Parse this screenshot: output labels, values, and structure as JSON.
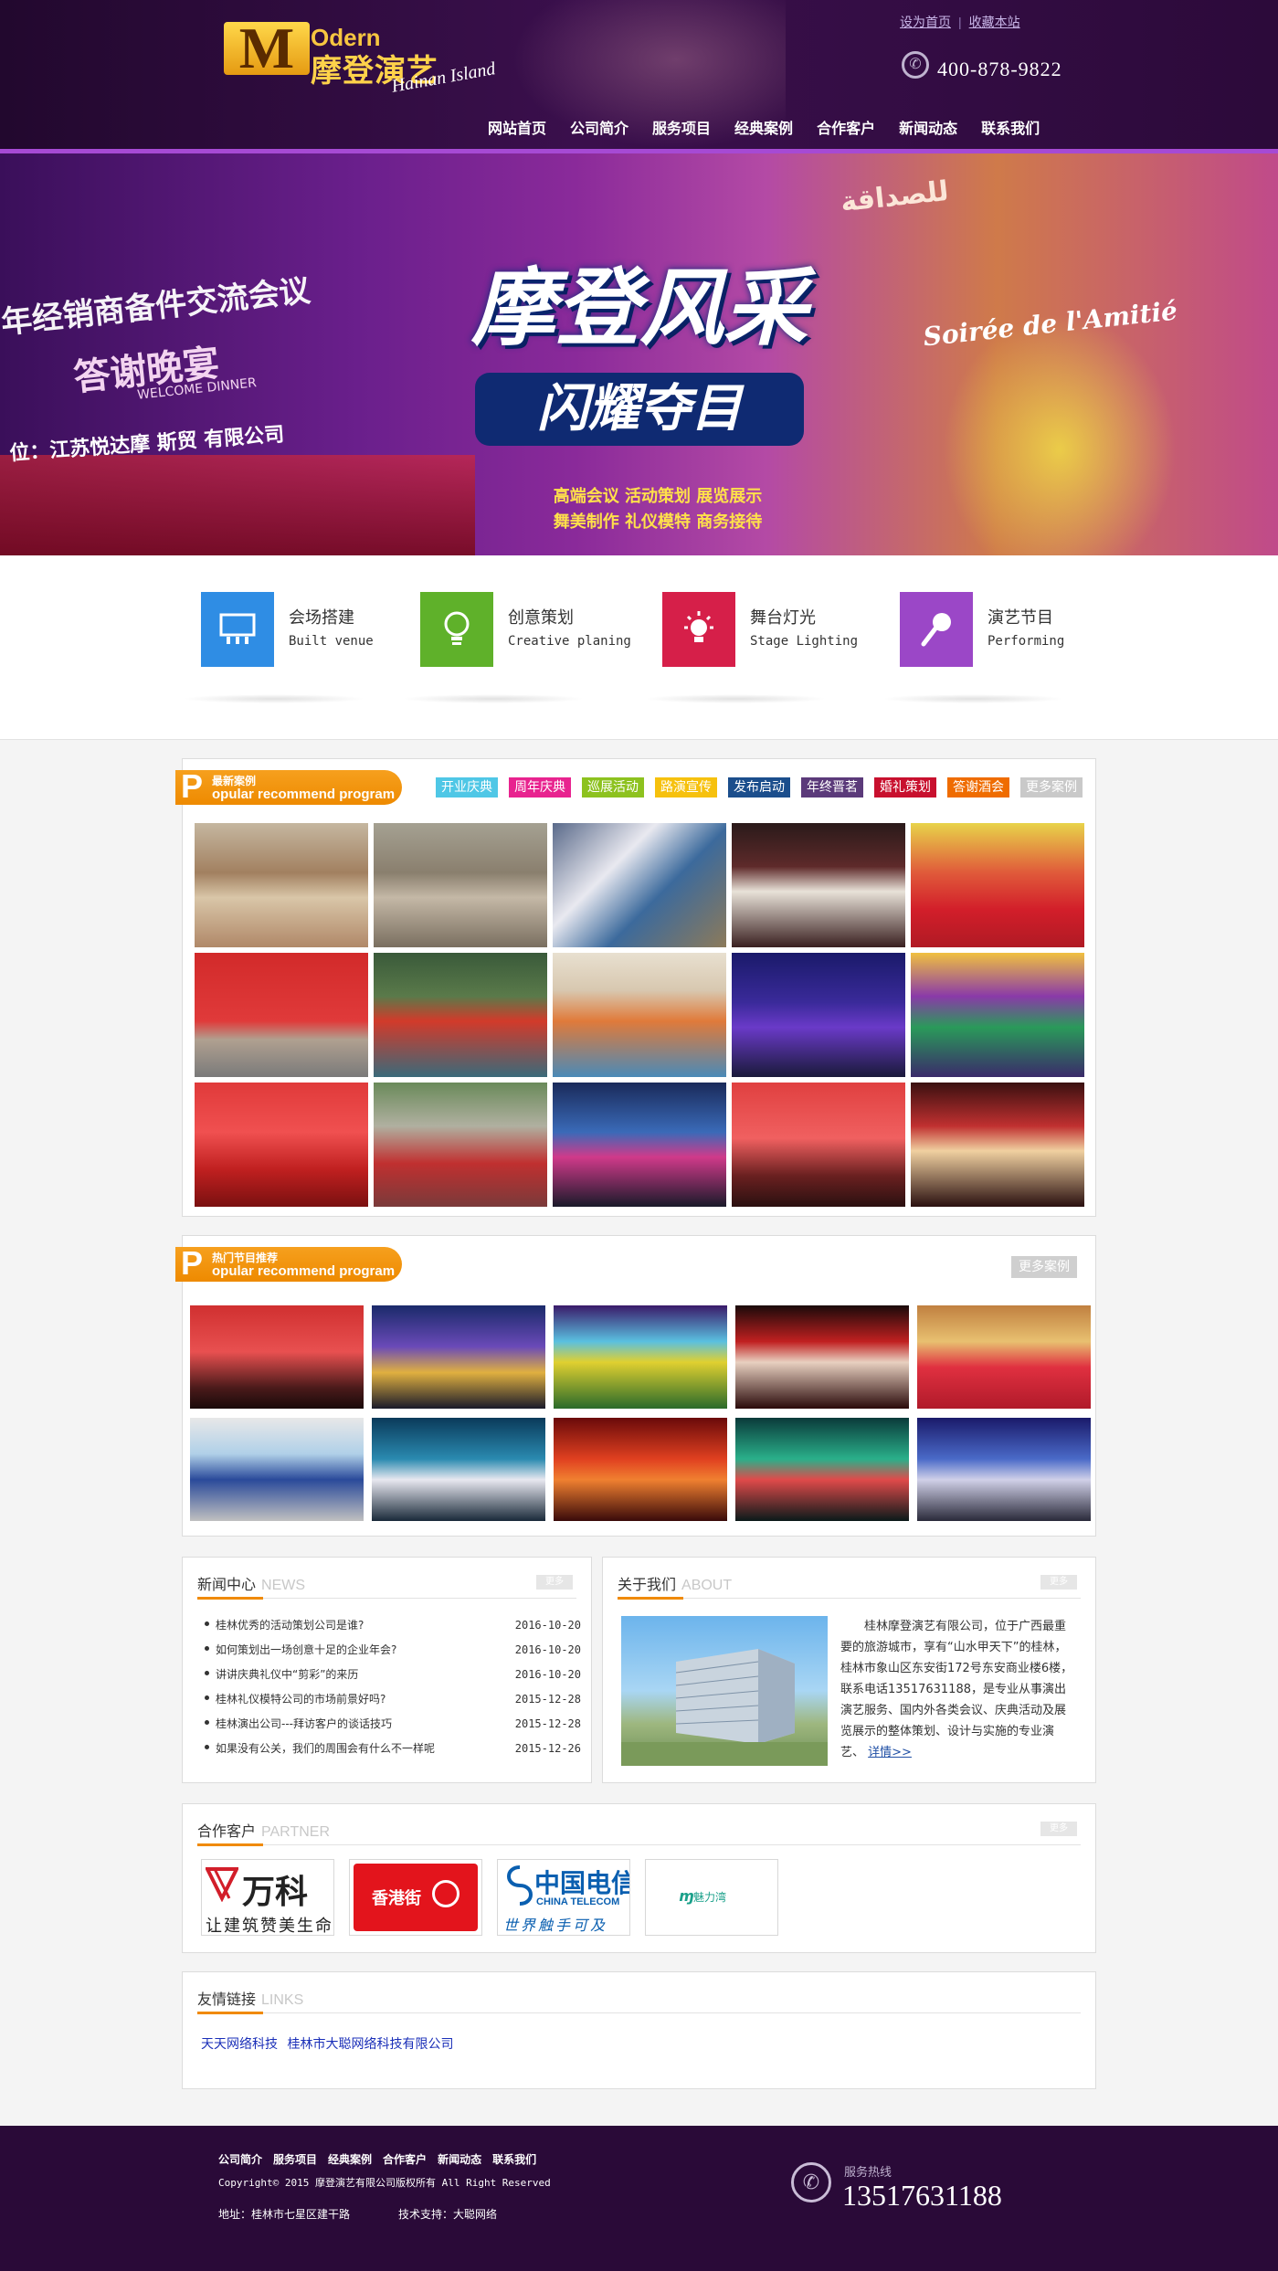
{
  "header": {
    "logo": {
      "mark": "M",
      "odern": "Odern",
      "name_cn": "摩登演艺",
      "subtitle": "Hainan Island"
    },
    "top_links": [
      "设为首页",
      "收藏本站"
    ],
    "phone": "400-878-9822",
    "phone_icon": "phone-icon",
    "nav": [
      "网站首页",
      "公司简介",
      "服务项目",
      "经典案例",
      "合作客户",
      "新闻动态",
      "联系我们"
    ]
  },
  "banner": {
    "left_text": "年经销商备件交流会议",
    "welcome": "答谢晚宴",
    "welcome_en": "WELCOME DINNER",
    "sponsor": "位：江苏悦达摩   斯贸   有限公司",
    "arabic": "للصداقة",
    "right_text": "Soirée de l'Amitié",
    "title_line1": "摩登风采",
    "title_line2": "闪耀夺目",
    "tags_line1": "高端会议   活动策划   展览展示",
    "tags_line2": "舞美制作   礼仪模特   商务接待"
  },
  "services": [
    {
      "cn": "会场搭建",
      "en": "Built venue",
      "color": "#2f8de4",
      "icon": "venue-icon"
    },
    {
      "cn": "创意策划",
      "en": "Creative planing",
      "color": "#5fb12a",
      "icon": "bulb-icon"
    },
    {
      "cn": "舞台灯光",
      "en": "Stage Lighting",
      "color": "#d61f49",
      "icon": "light-icon"
    },
    {
      "cn": "演艺节目",
      "en": "Performing",
      "color": "#9b47c7",
      "icon": "microphone-icon"
    }
  ],
  "cases": {
    "ribbon_small": "最新案例",
    "ribbon_letter": "P",
    "ribbon_big": "opular recommend program",
    "tags": [
      {
        "label": "开业庆典",
        "color": "#4fc7e6"
      },
      {
        "label": "周年庆典",
        "color": "#e8238f"
      },
      {
        "label": "巡展活动",
        "color": "#8dc21f"
      },
      {
        "label": "路演宣传",
        "color": "#f6c10e"
      },
      {
        "label": "发布启动",
        "color": "#1b4e8c"
      },
      {
        "label": "年终晋茗",
        "color": "#5b3a7a"
      },
      {
        "label": "婚礼策划",
        "color": "#c8102e"
      },
      {
        "label": "答谢酒会",
        "color": "#ef6c00"
      },
      {
        "label": "更多案例",
        "color": "#c9c9c9"
      }
    ]
  },
  "hot": {
    "ribbon_small": "热门节目推荐",
    "ribbon_letter": "P",
    "ribbon_big": "opular recommend program",
    "more": "更多案例"
  },
  "news": {
    "title": "新闻中心",
    "title_en": "NEWS",
    "more": "更多",
    "items": [
      {
        "title": "桂林优秀的活动策划公司是谁?",
        "date": "2016-10-20"
      },
      {
        "title": "如何策划出一场创意十足的企业年会?",
        "date": "2016-10-20"
      },
      {
        "title": "讲讲庆典礼仪中“剪彩”的来历",
        "date": "2016-10-20"
      },
      {
        "title": "桂林礼仪模特公司的市场前景好吗?",
        "date": "2015-12-28"
      },
      {
        "title": "桂林演出公司---拜访客户的谈话技巧",
        "date": "2015-12-28"
      },
      {
        "title": "如果没有公关，我们的周围会有什么不一样呢",
        "date": "2015-12-26"
      }
    ]
  },
  "about": {
    "title": "关于我们",
    "title_en": "ABOUT",
    "more": "更多",
    "text": "桂林摩登演艺有限公司，位于广西最重要的旅游城市，享有“山水甲天下”的桂林，桂林市象山区东安街172号东安商业楼6楼，联系电话13517631188，是专业从事演出演艺服务、国内外各类会议、庆典活动及展览展示的整体策划、设计与实施的专业演艺、",
    "link": "详情>>"
  },
  "partners": {
    "title": "合作客户",
    "title_en": "PARTNER",
    "more": "更多",
    "logos": [
      {
        "main": "万科",
        "sub": "让建筑赞美生命"
      },
      {
        "main": "香港街",
        "sub": ""
      },
      {
        "main": "中国电信",
        "sub": "CHINA TELECOM",
        "sub2": "世界触手可及"
      },
      {
        "main": "魅力湾",
        "sub": ""
      }
    ]
  },
  "links": {
    "title": "友情链接",
    "title_en": "LINKS",
    "items": [
      "天天网络科技",
      "桂林市大聪网络科技有限公司"
    ]
  },
  "footer": {
    "links": [
      "公司简介",
      "服务项目",
      "经典案例",
      "合作客户",
      "新闻动态",
      "联系我们"
    ],
    "copyright": "Copyright© 2015 摩登演艺有限公司版权所有 All Right Reserved",
    "address": "地址：桂林市七星区建干路",
    "tech": "技术支持：大聪网络",
    "hotline_label": "服务热线",
    "hotline": "13517631188"
  }
}
